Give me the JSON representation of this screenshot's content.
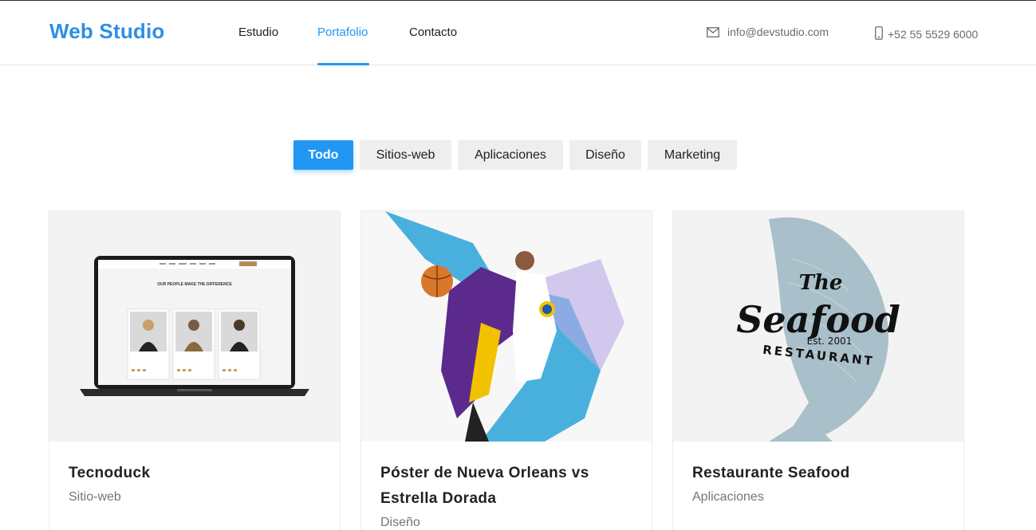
{
  "brand": {
    "name": "Web Studio",
    "accent": "#2196f3"
  },
  "nav": {
    "items": [
      {
        "label": "Estudio"
      },
      {
        "label": "Portafolio",
        "active": true
      },
      {
        "label": "Contacto"
      }
    ]
  },
  "contact": {
    "email": "info@devstudio.com",
    "phone": "+52 55 5529 6000",
    "email_icon": "mail-icon",
    "phone_icon": "mobile-phone-icon"
  },
  "filters": [
    {
      "label": "Todo",
      "active": true
    },
    {
      "label": "Sitios-web"
    },
    {
      "label": "Aplicaciones"
    },
    {
      "label": "Diseño"
    },
    {
      "label": "Marketing"
    }
  ],
  "portfolio": [
    {
      "title": "Tecnoduck",
      "category": "Sitio-web"
    },
    {
      "title": "Póster de Nueva Orleans vs Estrella Dorada",
      "category": "Diseño"
    },
    {
      "title": "Restaurante Seafood",
      "category": "Aplicaciones"
    }
  ],
  "thumbnails": {
    "laptop": {
      "heading": "OUR PEOPLE MAKE THE DIFFERENCE"
    },
    "seafood": {
      "line1": "The",
      "line2": "Seafood",
      "line3": "Est. 2001",
      "line4": "RESTAURANT"
    }
  }
}
